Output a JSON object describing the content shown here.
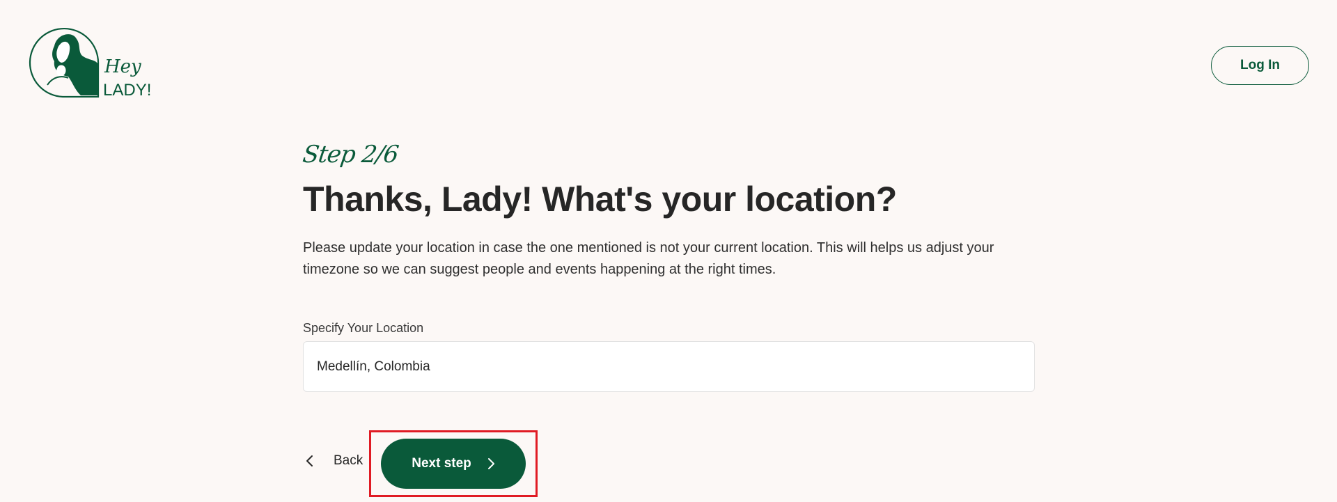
{
  "header": {
    "logo_text_top": "Hey",
    "logo_text_bottom": "LADY!",
    "login_label": "Log In"
  },
  "main": {
    "step_label": "Step 2/6",
    "title": "Thanks, Lady! What's your location?",
    "description": "Please update your location in case the one mentioned is not your current location. This will helps us adjust your timezone so we can suggest people and events happening at the right times.",
    "location_label": "Specify Your Location",
    "location_value": "Medellín, Colombia"
  },
  "actions": {
    "back_label": "Back",
    "next_label": "Next step"
  },
  "colors": {
    "brand_green": "#0a5a3a",
    "background": "#fcf8f6",
    "highlight_red": "#e01b24"
  },
  "icons": {
    "logo": "hey-lady-logo-icon",
    "back": "chevron-left-icon",
    "next": "chevron-right-icon"
  }
}
